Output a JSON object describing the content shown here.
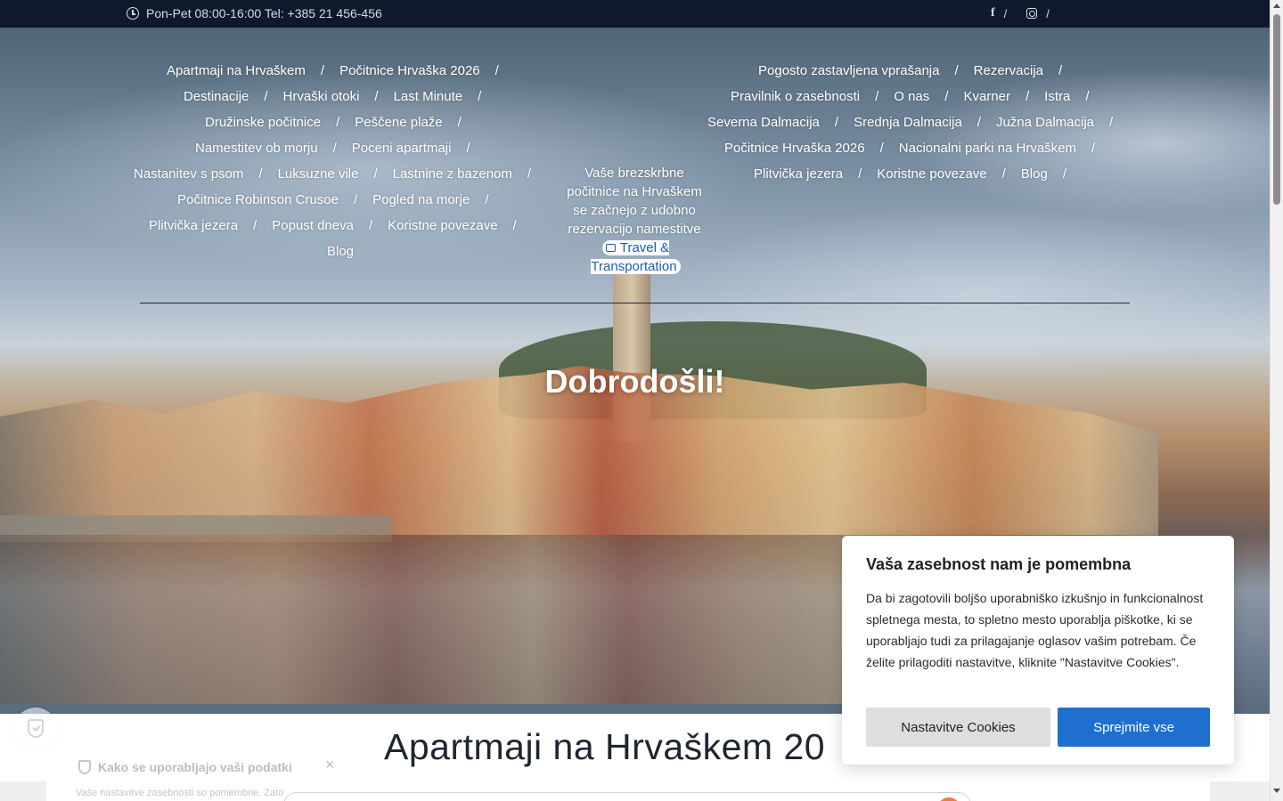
{
  "topbar": {
    "hours_text": "Pon-Pet 08:00-16:00 Tel: +385 21 456-456",
    "separator": "/"
  },
  "nav_left": {
    "rows": [
      [
        "Apartmaji na Hrvaškem",
        "Počitnice Hrvaška 2026"
      ],
      [
        "Destinacije",
        "Hrvaški otoki",
        "Last Minute"
      ],
      [
        "Družinske počitnice",
        "Peščene plaže"
      ],
      [
        "Namestitev ob morju",
        "Poceni apartmaji"
      ],
      [
        "Nastanitev s psom",
        "Luksuzne vile",
        "Lastnine z bazenom"
      ],
      [
        "Počitnice Robinson Crusoe",
        "Pogled na morje"
      ],
      [
        "Plitvička jezera",
        "Popust dneva",
        "Koristne povezave"
      ],
      [
        "Blog"
      ]
    ]
  },
  "nav_right": {
    "rows": [
      [
        "Pogosto zastavljena vprašanja",
        "Rezervacija"
      ],
      [
        "Pravilnik o zasebnosti",
        "O nas",
        "Kvarner",
        "Istra"
      ],
      [
        "Severna Dalmacija",
        "Srednja Dalmacija",
        "Južna Dalmacija"
      ],
      [
        "Počitnice Hrvaška 2026",
        "Nacionalni parki na Hrvaškem"
      ],
      [
        "Plitvička jezera",
        "Koristne povezave",
        "Blog"
      ]
    ]
  },
  "nav_separator": "/",
  "tagline": "Vaše brezskrbne počitnice na Hrvaškem se začnejo z udobno rezervacijo namestitve",
  "travel_link": "Travel & Transportation",
  "hero": {
    "welcome": "Dobrodošli!"
  },
  "main": {
    "heading": "Apartmaji na Hrvaškem 20"
  },
  "data_popup": {
    "title": "Kako se uporabljajo vaši podatki",
    "text": "Vaše nastavitve zasebnosti so pomembne. Zato"
  },
  "cookie_banner": {
    "title": "Vaša zasebnost nam je pomembna",
    "text": "Da bi zagotovili boljšo uporabniško izkušnjo in funkcionalnost spletnega mesta, to spletno mesto uporablja piškotke, ki se uporabljajo tudi za prilagajanje oglasov vašim potrebam. Če želite prilagoditi nastavitve, kliknite \"Nastavitve Cookies\".",
    "settings_label": "Nastavitve Cookies",
    "accept_label": "Sprejmite vse"
  }
}
